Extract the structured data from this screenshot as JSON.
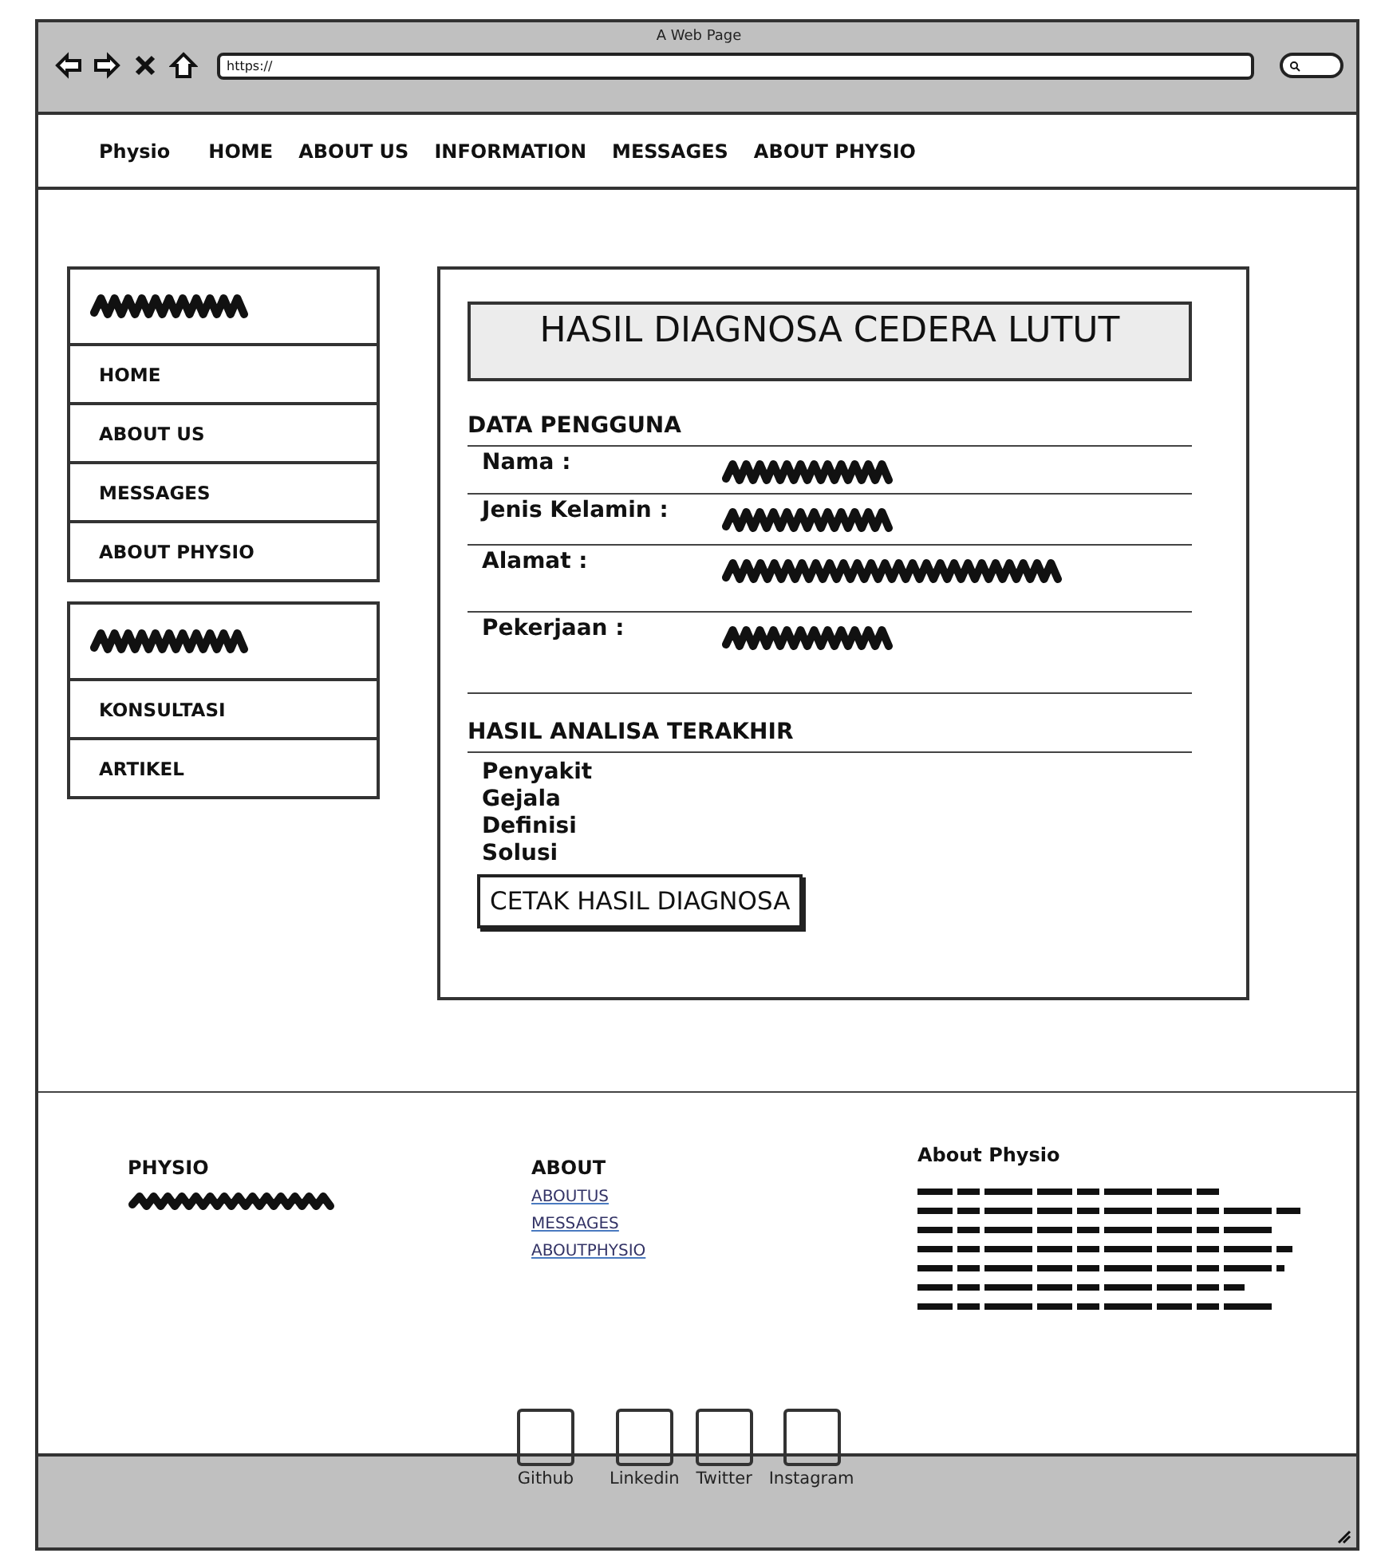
{
  "browser": {
    "title": "A Web Page",
    "url": "https://"
  },
  "navbar": {
    "brand": "Physio",
    "links": [
      "HOME",
      "ABOUT US",
      "INFORMATION",
      "MESSAGES",
      "ABOUT PHYSIO"
    ]
  },
  "sidebar": {
    "groups": [
      {
        "items": [
          "HOME",
          "ABOUT US",
          "MESSAGES",
          "ABOUT PHYSIO"
        ]
      },
      {
        "items": [
          "KONSULTASI",
          "ARTIKEL"
        ]
      }
    ]
  },
  "main": {
    "title": "HASIL DIAGNOSA CEDERA LUTUT",
    "user_section": {
      "heading": "DATA PENGGUNA",
      "fields": [
        "Nama :",
        "Jenis Kelamin :",
        "Alamat :",
        "Pekerjaan :"
      ]
    },
    "result_section": {
      "heading": "HASIL ANALISA TERAKHIR",
      "items": [
        "Penyakit",
        "Gejala",
        "Definisi",
        "Solusi"
      ]
    },
    "print_button": "CETAK HASIL DIAGNOSA"
  },
  "footer": {
    "brand": "PHYSIO",
    "about_heading": "ABOUT",
    "about_links": [
      "ABOUTUS",
      "MESSAGES",
      "ABOUTPHYSIO"
    ],
    "info_heading": "About Physio",
    "social": [
      "Github",
      "Linkedin",
      "Twitter",
      "Instagram"
    ]
  }
}
